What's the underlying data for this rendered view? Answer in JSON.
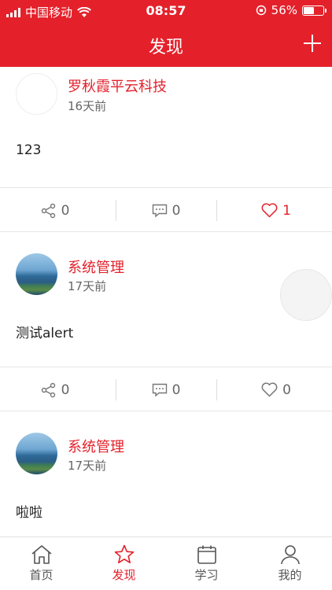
{
  "status": {
    "carrier": "中国移动",
    "time": "08:57",
    "battery": "56%",
    "battery_level": 0.56
  },
  "header": {
    "title": "发现",
    "add_icon": "plus-icon"
  },
  "posts": [
    {
      "name": "罗秋霞平云科技",
      "date": "16天前",
      "content": "123",
      "share_count": "0",
      "comment_count": "0",
      "like_count": "1",
      "liked": true
    },
    {
      "name": "系统管理",
      "date": "17天前",
      "content": "测试alert",
      "share_count": "0",
      "comment_count": "0",
      "like_count": "0",
      "liked": false
    },
    {
      "name": "系统管理",
      "date": "17天前",
      "content": "啦啦"
    }
  ],
  "tabs": [
    {
      "label": "首页",
      "icon": "home-icon"
    },
    {
      "label": "发现",
      "icon": "star-icon",
      "active": true
    },
    {
      "label": "学习",
      "icon": "calendar-icon"
    },
    {
      "label": "我的",
      "icon": "user-icon"
    }
  ],
  "colors": {
    "brand": "#e4212b",
    "muted": "#666666"
  }
}
